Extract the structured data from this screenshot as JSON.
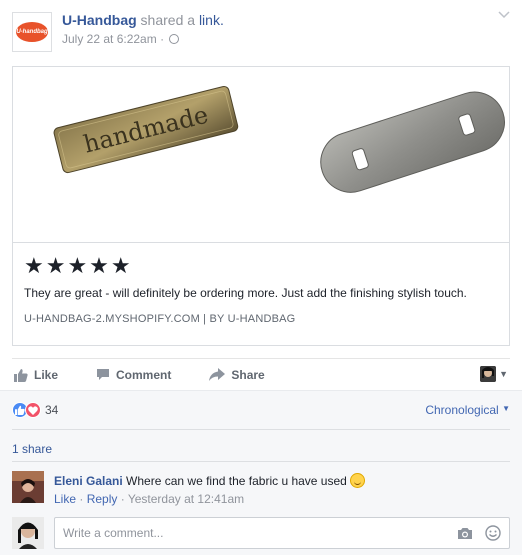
{
  "header": {
    "page_name": "U-Handbag",
    "action_text": " shared a ",
    "link_text": "link.",
    "timestamp": "July 22 at 6:22am",
    "separator": "·",
    "logo_text": "U-handbag"
  },
  "card": {
    "stamp_text": "handmade",
    "stars": "★★★★★",
    "description": "They are great - will definitely be ordering more. Just add the finishing stylish touch.",
    "domain": "U-HANDBAG-2.MYSHOPIFY.COM | BY U-HANDBAG"
  },
  "actions": {
    "like": "Like",
    "comment": "Comment",
    "share": "Share"
  },
  "feedback": {
    "reaction_count": "34",
    "sort_label": "Chronological",
    "shares": "1 share"
  },
  "comment": {
    "author": "Eleni Galani",
    "text": " Where can we find the fabric u have used",
    "like": "Like",
    "reply": "Reply",
    "dot": " · ",
    "time": "Yesterday at 12:41am"
  },
  "compose": {
    "placeholder": "Write a comment..."
  },
  "colors": {
    "link_blue": "#365899",
    "like_blue": "#4a8af4",
    "love_red": "#f25268",
    "feedback_bg": "#f6f7f9"
  },
  "icons": [
    "globe-icon",
    "chevron-down-icon",
    "thumbs-up-icon",
    "comment-bubble-icon",
    "share-arrow-icon",
    "camera-icon",
    "smiley-icon",
    "like-reaction-icon",
    "love-reaction-icon"
  ]
}
